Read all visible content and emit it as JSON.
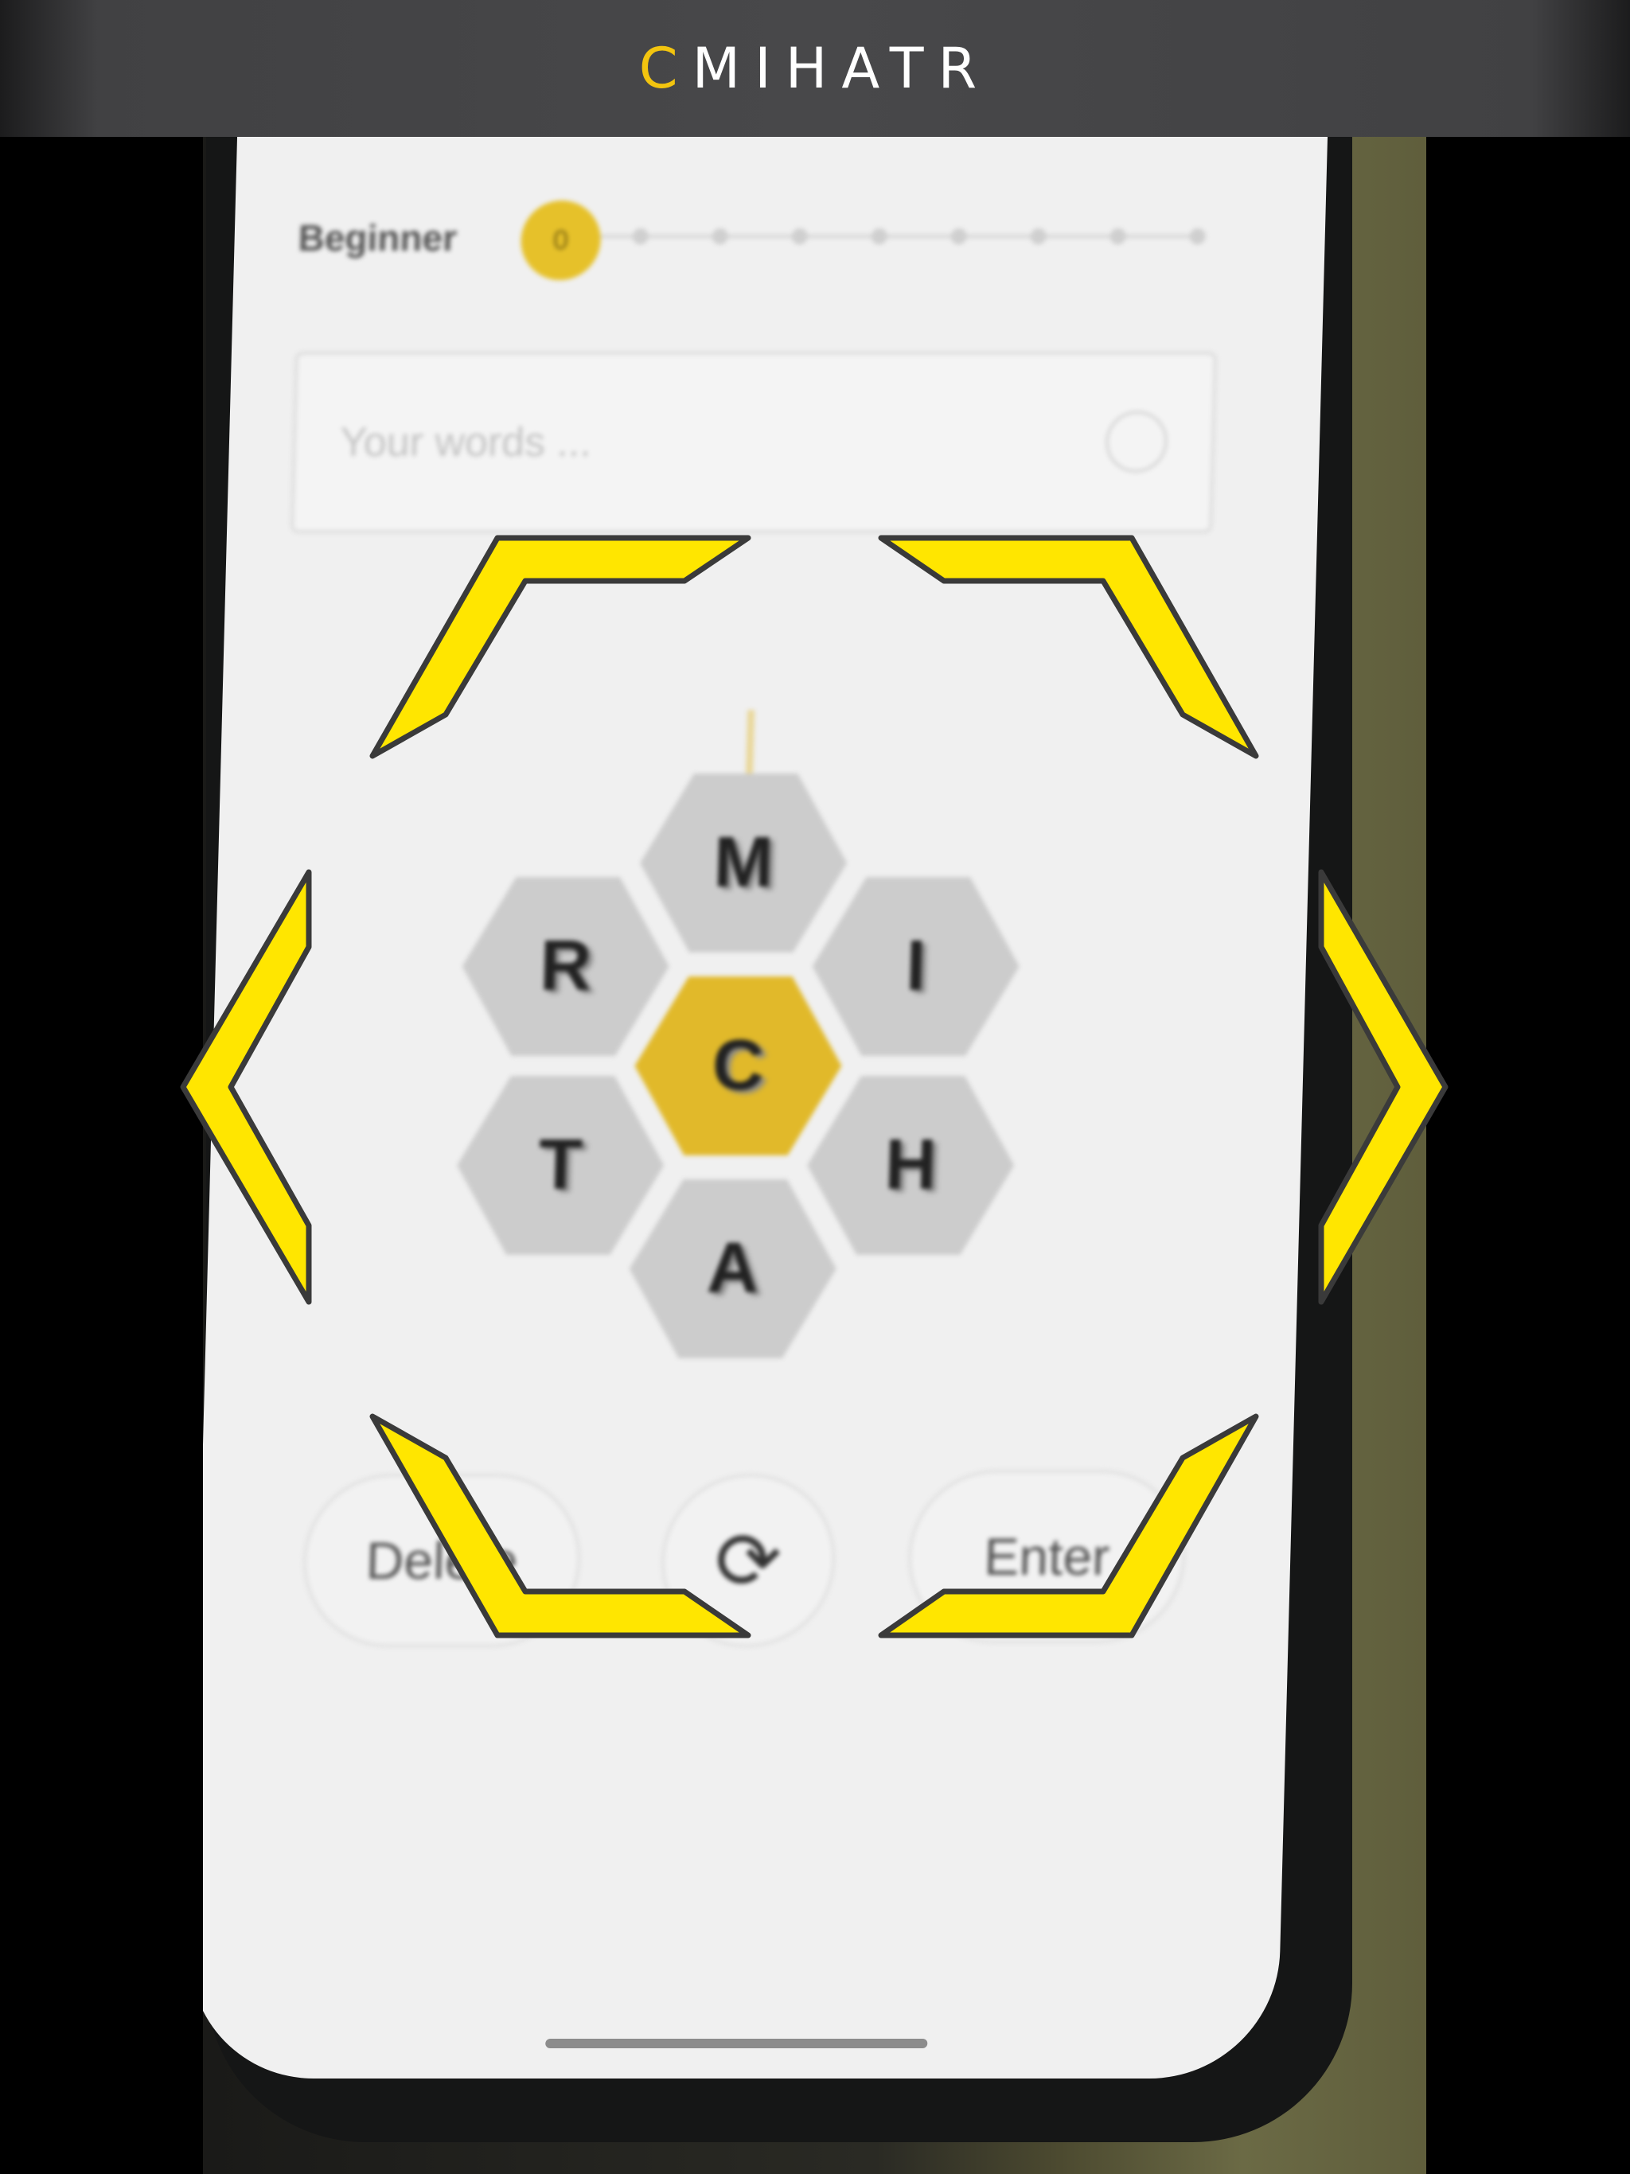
{
  "scanner": {
    "detected_first_letter": "C",
    "detected_rest": "MIHATR",
    "overlay_color": "#ffe600",
    "letter_highlight_color": "#f2c40f"
  },
  "game": {
    "rank_label": "Beginner",
    "score": "0",
    "word_input_placeholder": "Your words ...",
    "letters": {
      "center": "C",
      "top": "M",
      "upper_left": "R",
      "upper_right": "I",
      "lower_left": "T",
      "lower_right": "H",
      "bottom": "A"
    },
    "delete_label": "Delete",
    "enter_label": "Enter",
    "shuffle_icon": "shuffle-icon",
    "accent_color": "#e1b92a"
  }
}
